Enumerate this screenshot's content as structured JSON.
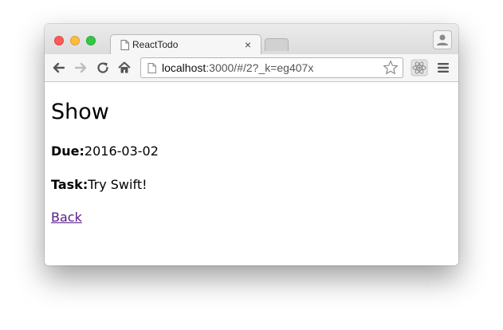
{
  "browser": {
    "tab_title": "ReactTodo",
    "tab_close": "×",
    "url_host": "localhost",
    "url_rest": ":3000/#/2?_k=eg407x",
    "icons": {
      "close": "close-icon",
      "minimize": "minimize-icon",
      "zoom": "zoom-icon",
      "back": "back-arrow-icon",
      "forward": "forward-arrow-icon",
      "reload": "reload-icon",
      "home": "home-icon",
      "page": "page-icon",
      "bookmark": "star-icon",
      "extension": "react-devtools-icon",
      "menu": "hamburger-menu-icon",
      "profile": "profile-icon"
    },
    "colors": {
      "close": "#fc5b57",
      "minimize": "#fdbc40",
      "zoom": "#33c748"
    }
  },
  "page": {
    "heading": "Show",
    "due_label": "Due:",
    "due_value": "2016-03-02",
    "task_label": "Task:",
    "task_value": "Try Swift!",
    "back_link": "Back",
    "link_color": "#551a8b"
  }
}
